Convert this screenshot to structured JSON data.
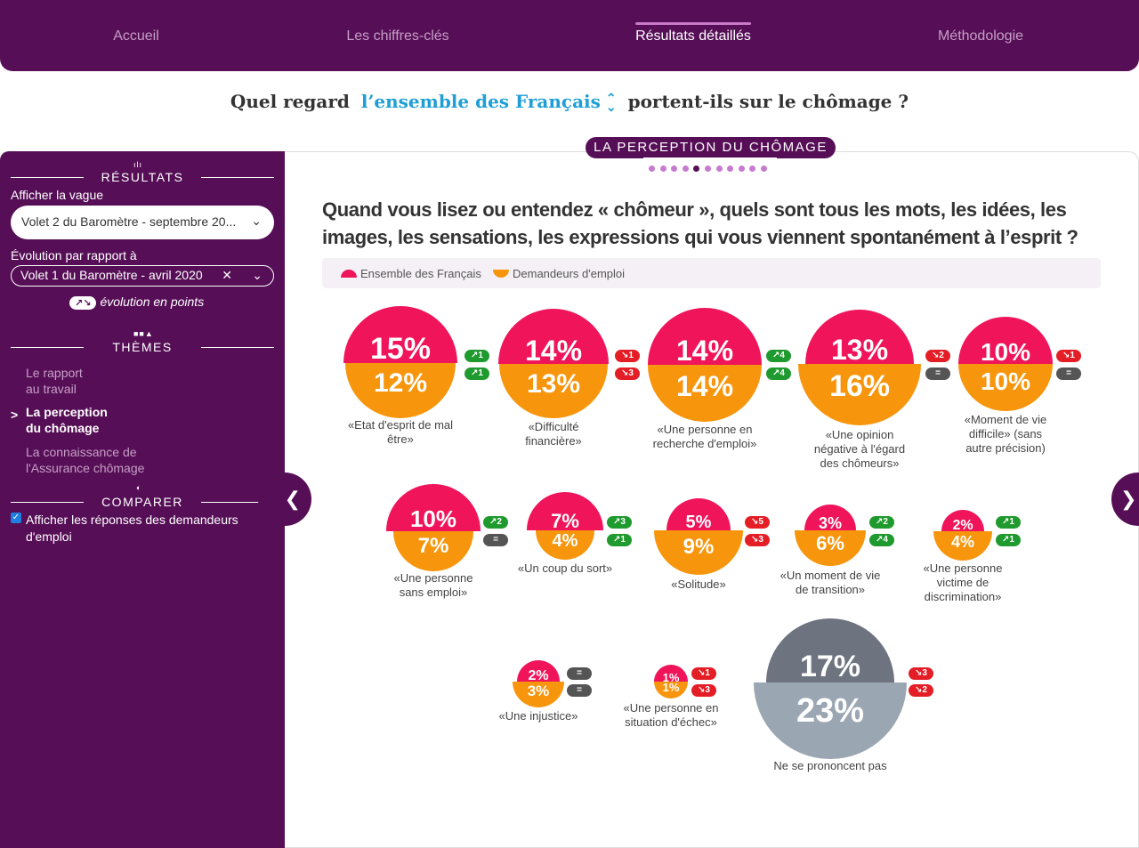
{
  "nav": {
    "items": [
      "Accueil",
      "Les chiffres-clés",
      "Résultats détaillés",
      "Méthodologie"
    ],
    "active": "Résultats détaillés"
  },
  "question_bar": {
    "prefix": "Quel regard",
    "selected": "l’ensemble des Français",
    "suffix": "portent-ils sur le chômage ?"
  },
  "sidebar": {
    "results_title": "RÉSULTATS",
    "wave_label": "Afficher la vague",
    "wave_value": "Volet 2 du Baromètre - septembre 20...",
    "evolution_label": "Évolution par rapport à",
    "evolution_value": "Volet 1 du Baromètre - avril 2020",
    "evolution_clear": "✕",
    "evolution_note": "évolution en points",
    "evolution_note_pill": "↗↘",
    "themes_title": "THÈMES",
    "themes": [
      "Le rapport\nau travail",
      "La perception\ndu chômage",
      "La connaissance de\nl'Assurance chômage"
    ],
    "compare_title": "COMPARER",
    "compare_label": "Afficher les réponses des demandeurs d'emploi",
    "compare_checked": true
  },
  "section": {
    "name": "LA PERCEPTION DU CHÔMAGE",
    "dot_count": 11,
    "active_dot": 4
  },
  "main": {
    "question": "Quand vous lisez ou entendez « chômeur », quels sont tous les mots, les idées, les images, les sensations, les expressions qui vous viennent spontanément à l’esprit ?",
    "legend": [
      "Ensemble des Français",
      "Demandeurs d'emploi"
    ],
    "colors": {
      "ensemble": "#f0145a",
      "demandeurs": "#f7960d",
      "up": "#1f9a2e",
      "down": "#e41e26",
      "equal": "#555555"
    }
  },
  "chart_data": {
    "type": "bubble",
    "series": [
      {
        "name": "Ensemble des Français"
      },
      {
        "name": "Demandeurs d'emploi"
      }
    ],
    "items": [
      {
        "label": "«Etat d'esprit de mal être»",
        "ensemble": "15%",
        "demandeurs": "12%",
        "evo_ensemble": "↗1",
        "evo_ens_dir": "up",
        "evo_demandeurs": "↗1",
        "evo_dem_dir": "up"
      },
      {
        "label": "«Difficulté financière»",
        "ensemble": "14%",
        "demandeurs": "13%",
        "evo_ensemble": "↘1",
        "evo_ens_dir": "down",
        "evo_demandeurs": "↘3",
        "evo_dem_dir": "down"
      },
      {
        "label": "«Une personne en recherche d'emploi»",
        "ensemble": "14%",
        "demandeurs": "14%",
        "evo_ensemble": "↗4",
        "evo_ens_dir": "up",
        "evo_demandeurs": "↗4",
        "evo_dem_dir": "up"
      },
      {
        "label": "«Une opinion négative à l'égard des chômeurs»",
        "ensemble": "13%",
        "demandeurs": "16%",
        "evo_ensemble": "↘2",
        "evo_ens_dir": "down",
        "evo_demandeurs": "=",
        "evo_dem_dir": "eq"
      },
      {
        "label": "«Moment de vie difficile» (sans autre précision)",
        "ensemble": "10%",
        "demandeurs": "10%",
        "evo_ensemble": "↘1",
        "evo_ens_dir": "down",
        "evo_demandeurs": "=",
        "evo_dem_dir": "eq"
      },
      {
        "label": "«Une personne sans emploi»",
        "ensemble": "10%",
        "demandeurs": "7%",
        "evo_ensemble": "↗2",
        "evo_ens_dir": "up",
        "evo_demandeurs": "=",
        "evo_dem_dir": "eq"
      },
      {
        "label": "«Un coup du sort»",
        "ensemble": "7%",
        "demandeurs": "4%",
        "evo_ensemble": "↗3",
        "evo_ens_dir": "up",
        "evo_demandeurs": "↗1",
        "evo_dem_dir": "up"
      },
      {
        "label": "«Solitude»",
        "ensemble": "5%",
        "demandeurs": "9%",
        "evo_ensemble": "↘5",
        "evo_ens_dir": "down",
        "evo_demandeurs": "↘3",
        "evo_dem_dir": "down"
      },
      {
        "label": "«Un moment de vie de transition»",
        "ensemble": "3%",
        "demandeurs": "6%",
        "evo_ensemble": "↗2",
        "evo_ens_dir": "up",
        "evo_demandeurs": "↗4",
        "evo_dem_dir": "up"
      },
      {
        "label": "«Une personne victime de discrimination»",
        "ensemble": "2%",
        "demandeurs": "4%",
        "evo_ensemble": "↗1",
        "evo_ens_dir": "up",
        "evo_demandeurs": "↗1",
        "evo_dem_dir": "up"
      },
      {
        "label": "«Une injustice»",
        "ensemble": "2%",
        "demandeurs": "3%",
        "evo_ensemble": "=",
        "evo_ens_dir": "eq",
        "evo_demandeurs": "=",
        "evo_dem_dir": "eq"
      },
      {
        "label": "«Une personne en situation d'échec»",
        "ensemble": "1%",
        "demandeurs": "1%",
        "evo_ensemble": "↘1",
        "evo_ens_dir": "down",
        "evo_demandeurs": "↘3",
        "evo_dem_dir": "down"
      },
      {
        "label": "Ne se prononcent pas",
        "ensemble": "17%",
        "demandeurs": "23%",
        "evo_ensemble": "↘3",
        "evo_ens_dir": "down",
        "evo_demandeurs": "↘2",
        "evo_dem_dir": "down",
        "neutral": true
      }
    ]
  }
}
